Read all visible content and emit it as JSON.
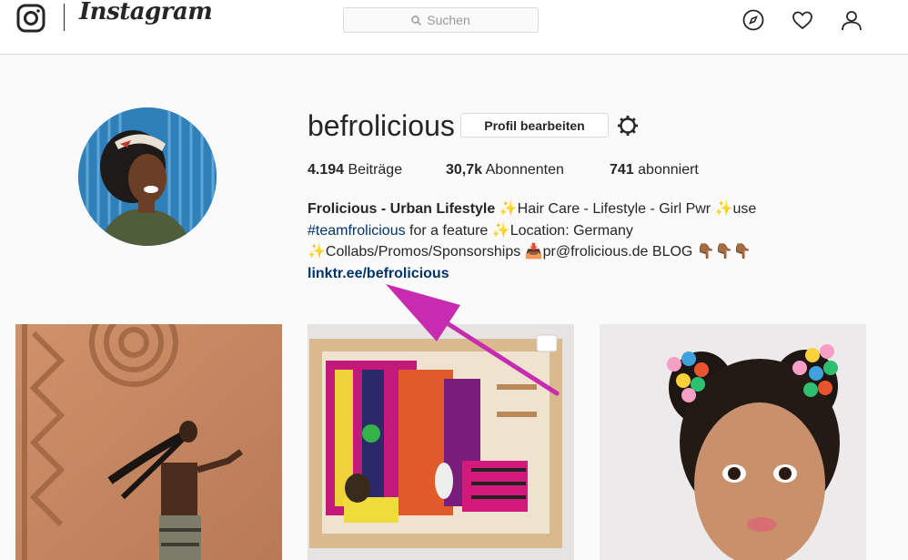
{
  "header": {
    "brand": "Instagram",
    "search_placeholder": "Suchen",
    "icons": [
      "instagram-logo-icon",
      "search-icon",
      "compass-icon",
      "heart-icon",
      "user-icon"
    ]
  },
  "profile": {
    "username": "befrolicious",
    "edit_label": "Profil bearbeiten",
    "stats": [
      {
        "count": "4.194",
        "label": "Beiträge"
      },
      {
        "count": "30,7k",
        "label": "Abonnenten"
      },
      {
        "count": "741",
        "label": "abonniert"
      }
    ],
    "bio": {
      "name": "Frolicious - Urban Lifestyle",
      "sparkle": "✨",
      "line1_rest": "Hair Care - Lifestyle - Girl Pwr ",
      "line1_end": "use",
      "hashtag": "#teamfrolicious",
      "line2_rest": " for a feature ",
      "line2_end": "Location: Germany",
      "line3_a": "Collabs/Promos/Sponsorships ",
      "mailbox": "📥",
      "line3_b": "pr@frolicious.de BLOG ",
      "hands": "👇🏾👇🏾👇🏾",
      "link": "linktr.ee/befrolicious"
    }
  },
  "colors": {
    "link": "#003569",
    "arrow": "#c62bb0"
  }
}
